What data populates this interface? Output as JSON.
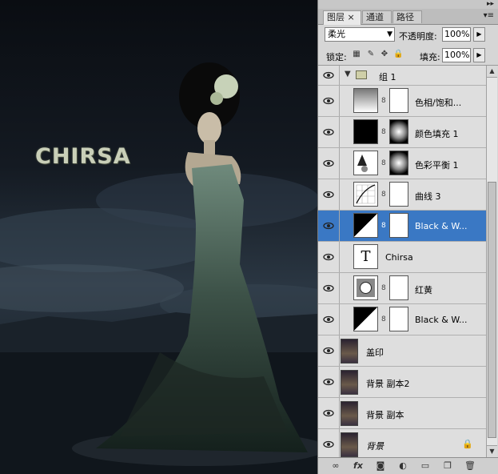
{
  "canvas": {
    "title_text": "CHIRSA"
  },
  "panel": {
    "tabs": [
      {
        "label": "图层",
        "close": "×",
        "active": true
      },
      {
        "label": "通道",
        "active": false
      },
      {
        "label": "路径",
        "active": false
      }
    ],
    "blend_mode": "柔光",
    "opacity_label": "不透明度:",
    "opacity_value": "100%",
    "lock_label": "锁定:",
    "fill_label": "填充:",
    "fill_value": "100%",
    "layers": [
      {
        "name": "组 1",
        "kind": "group"
      },
      {
        "name": "色相/饱和...",
        "kind": "adjustment",
        "icon": "hue-saturation-icon"
      },
      {
        "name": "颜色填充 1",
        "kind": "adjustment",
        "icon": "solid-color-icon"
      },
      {
        "name": "色彩平衡 1",
        "kind": "adjustment",
        "icon": "color-balance-icon"
      },
      {
        "name": "曲线 3",
        "kind": "adjustment",
        "icon": "curves-icon"
      },
      {
        "name": "Black & W...",
        "kind": "adjustment",
        "icon": "black-white-icon",
        "selected": true
      },
      {
        "name": "Chirsa",
        "kind": "text",
        "icon": "type-icon",
        "thumb_text": "T"
      },
      {
        "name": "红黄",
        "kind": "adjustment",
        "icon": "levels-icon"
      },
      {
        "name": "Black & W...",
        "kind": "adjustment",
        "icon": "black-white-icon"
      },
      {
        "name": "盖印",
        "kind": "pixel"
      },
      {
        "name": "背景 副本2",
        "kind": "pixel"
      },
      {
        "name": "背景 副本",
        "kind": "pixel"
      },
      {
        "name": "背景",
        "kind": "pixel",
        "locked": true
      }
    ]
  }
}
